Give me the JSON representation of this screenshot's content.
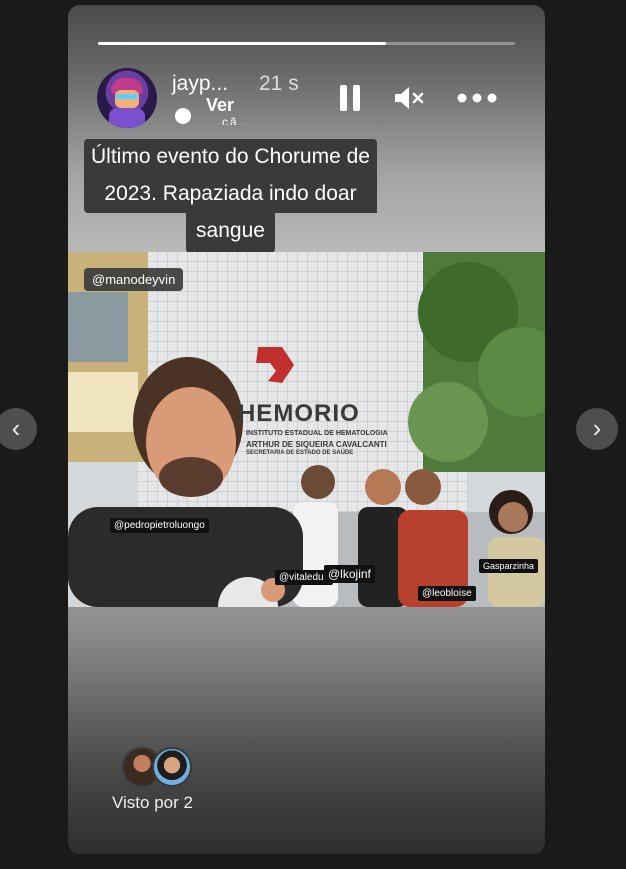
{
  "story": {
    "username": "jayp...",
    "time": "21 s",
    "audience_label": "Ver",
    "audience_sub": "...çã...",
    "progress": 0.69,
    "caption_lines": [
      "Último evento do Chorume de",
      "2023. Rapaziada indo doar",
      "sangue"
    ],
    "tags": {
      "top": "@manodeyvin",
      "t1": "@pedropietroluongo",
      "t2": "@vitaleduu",
      "t3": "@lkojinf",
      "t4": "@leobloise",
      "t5": "Gasparzinha"
    },
    "building_sign": {
      "name": "HEMORIO",
      "line1": "INSTITUTO ESTADUAL DE HEMATOLOGIA",
      "line2": "ARTHUR DE SIQUEIRA CAVALCANTI",
      "line3": "SECRETARIA DE ESTADO DE SAÚDE"
    },
    "viewed_by": "Visto por 2"
  },
  "icons": {
    "pause": "pause-icon",
    "mute": "speaker-muted-icon",
    "more": "more-horizontal-icon",
    "prev": "chevron-left-icon",
    "next": "chevron-right-icon",
    "globe": "globe-icon"
  }
}
